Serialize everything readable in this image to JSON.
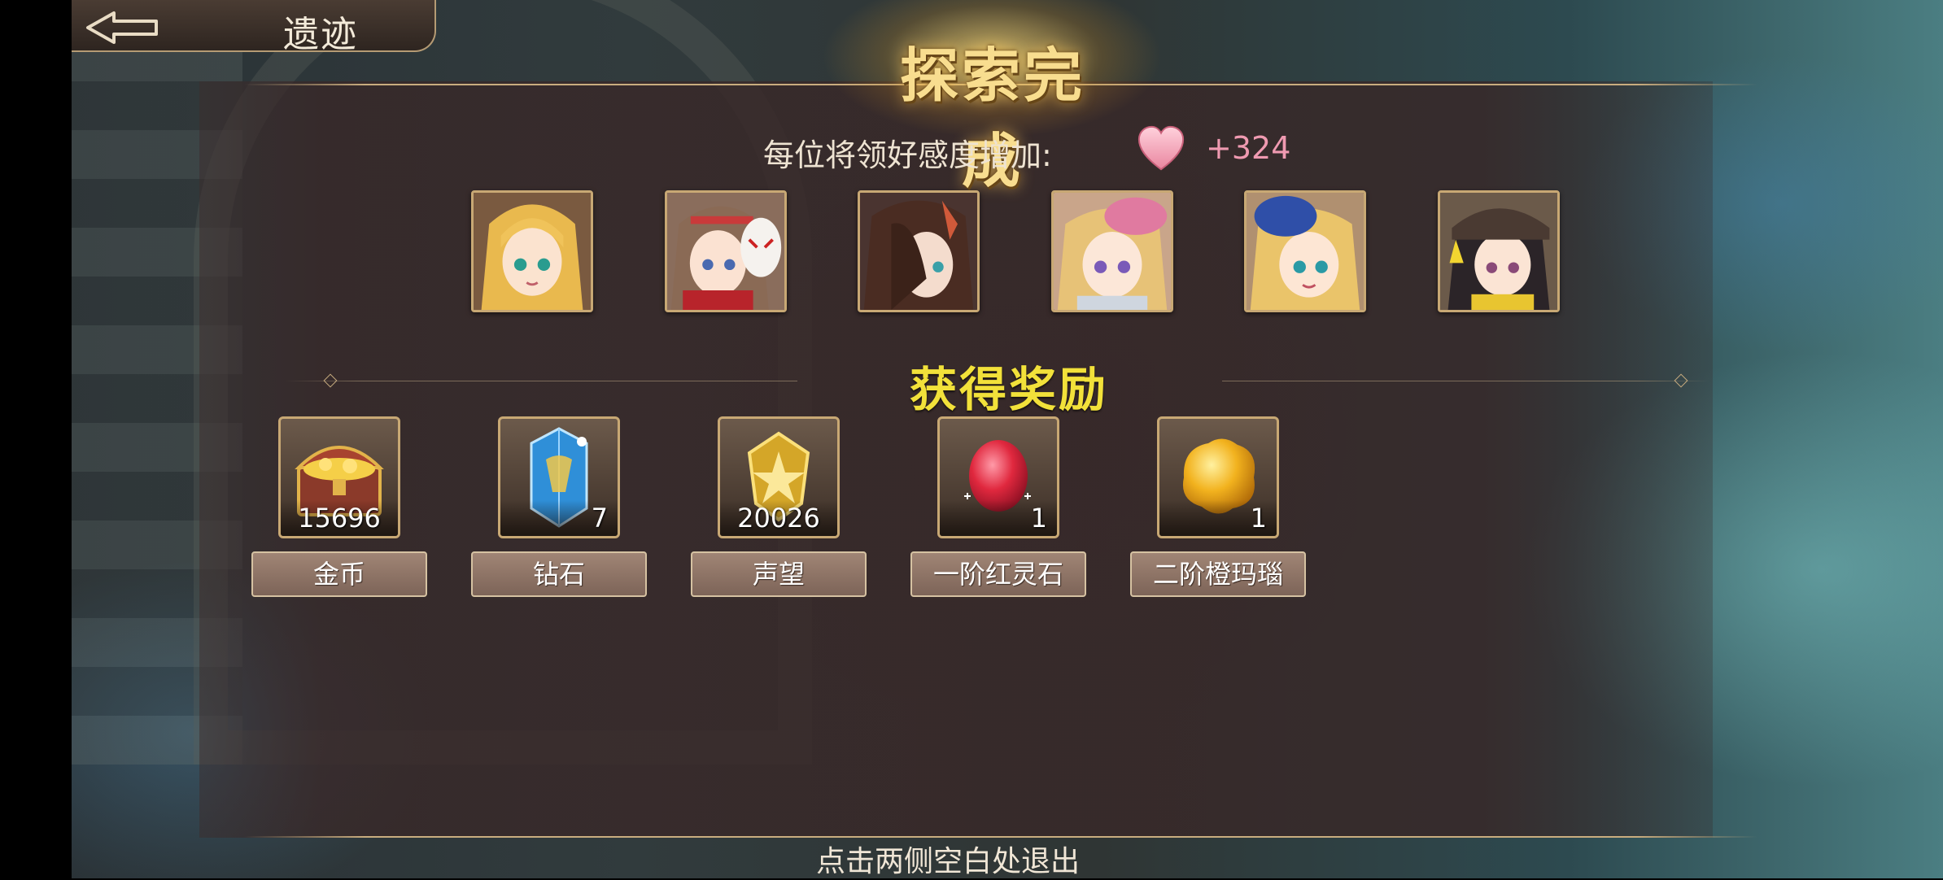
{
  "header": {
    "title": "遗迹",
    "back_icon": "back-arrow-icon"
  },
  "banner": {
    "title": "探索完成"
  },
  "affection": {
    "label": "每位将领好感度增加:",
    "value": "+324",
    "icon": "heart-icon",
    "color": "#ef9ab1"
  },
  "portraits": [
    {
      "name": "portrait-blonde-twin-tails"
    },
    {
      "name": "portrait-brunette-oni-mask"
    },
    {
      "name": "portrait-dark-hair-feather"
    },
    {
      "name": "portrait-blonde-pink-bonnet"
    },
    {
      "name": "portrait-blonde-blue-hat"
    },
    {
      "name": "portrait-black-hair-cap"
    }
  ],
  "rewards": {
    "heading": "获得奖励",
    "items": [
      {
        "label": "金币",
        "count": "15696",
        "icon": "treasure-chest-icon"
      },
      {
        "label": "钻石",
        "count": "7",
        "icon": "blue-crystal-icon"
      },
      {
        "label": "声望",
        "count": "20026",
        "icon": "gold-emblem-icon"
      },
      {
        "label": "一阶红灵石",
        "count": "1",
        "icon": "red-gem-icon"
      },
      {
        "label": "二阶橙玛瑙",
        "count": "1",
        "icon": "orange-agate-icon"
      }
    ]
  },
  "footer": {
    "hint": "点击两侧空白处退出"
  },
  "colors": {
    "accent_gold": "#c8a874",
    "reward_heading": "#f2e13a",
    "panel": "#382828"
  }
}
